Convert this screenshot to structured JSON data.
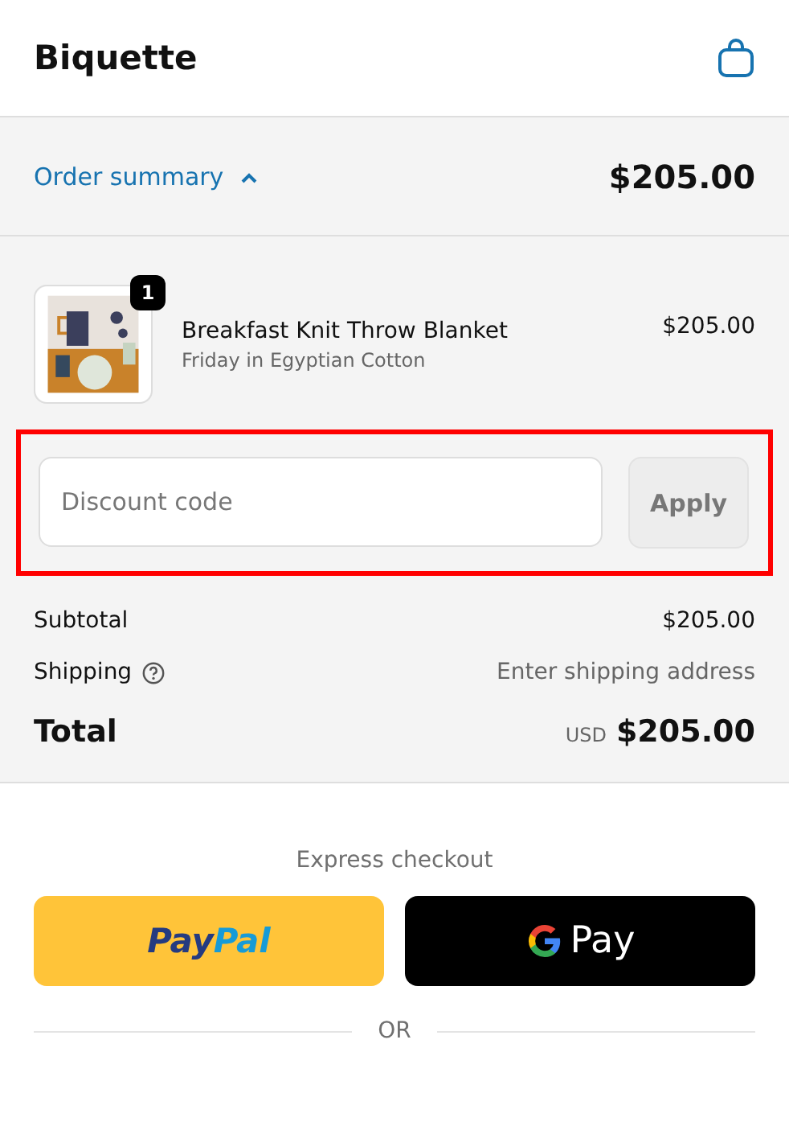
{
  "header": {
    "store_name": "Biquette"
  },
  "summary_toggle": {
    "label": "Order summary",
    "expanded": true,
    "amount": "$205.00"
  },
  "line_items": [
    {
      "name": "Breakfast Knit Throw Blanket",
      "variant": "Friday in Egyptian Cotton",
      "quantity": "1",
      "price": "$205.00"
    }
  ],
  "discount": {
    "placeholder": "Discount code",
    "button": "Apply",
    "button_disabled": true,
    "highlighted": true
  },
  "totals": [
    {
      "label": "Subtotal",
      "value": "$205.00",
      "kind": "amount",
      "help": false
    },
    {
      "label": "Shipping",
      "value": "Enter shipping address",
      "kind": "pending",
      "help": true
    }
  ],
  "total": {
    "label": "Total",
    "currency": "USD",
    "amount": "$205.00"
  },
  "express": {
    "title": "Express checkout",
    "buttons": [
      {
        "kind": "paypal",
        "parts": [
          "Pay",
          "Pal"
        ]
      },
      {
        "kind": "gpay",
        "label": "Pay"
      }
    ],
    "separator": "OR"
  }
}
